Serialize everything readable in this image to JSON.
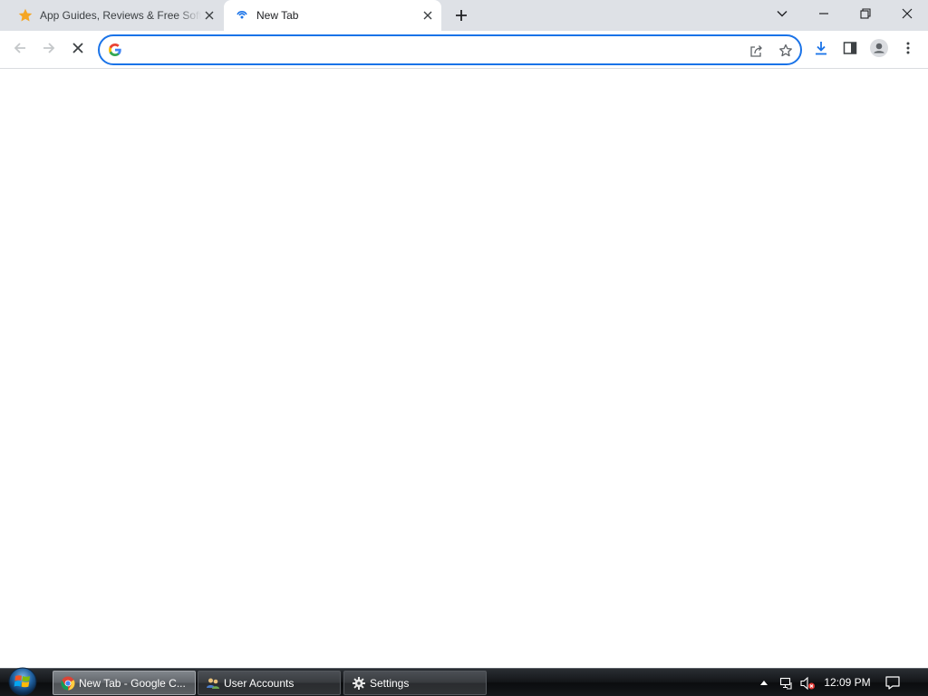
{
  "browser": {
    "tabs": [
      {
        "title": "App Guides, Reviews & Free Software",
        "icon": "star-icon",
        "active": false
      },
      {
        "title": "New Tab",
        "icon": "loading-spinner-icon",
        "active": true
      }
    ],
    "accent_color": "#1a73e8",
    "tabstrip_color": "#dee1e6"
  },
  "toolbar": {
    "omnibox": {
      "value": "",
      "placeholder": ""
    }
  },
  "taskbar": {
    "items": [
      {
        "label": "New Tab - Google C...",
        "icon": "chrome-icon"
      },
      {
        "label": "User Accounts",
        "icon": "user-accounts-icon"
      },
      {
        "label": "Settings",
        "icon": "gear-icon"
      }
    ],
    "clock": "12:09 PM"
  }
}
